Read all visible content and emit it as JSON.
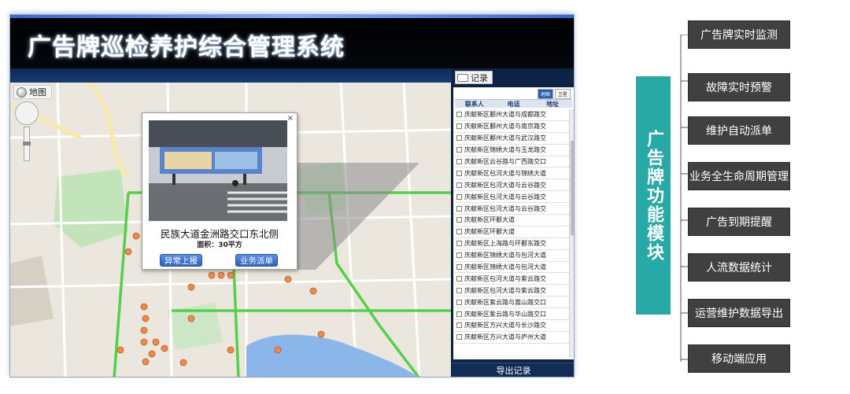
{
  "app": {
    "title": "广告牌巡检养护综合管理系统"
  },
  "map": {
    "tab_label": "地图",
    "popup": {
      "close_label": "×",
      "location": "民族大道金洲路交口东北侧",
      "area": "面积：30平方",
      "btn_report": "异常上报",
      "btn_dispatch": "业务派单"
    }
  },
  "records": {
    "tab_label": "记录",
    "mini_tabs": [
      "地图",
      "卫星"
    ],
    "columns": [
      "联系人",
      "电话",
      "地址"
    ],
    "rows": [
      "庆献新区鄱州大道与成都路交",
      "庆献新区鄱州大道与南京路交",
      "庆献新区鄱州大道与武汉路交",
      "庆献新区锦绣大道与玉龙路交",
      "庆献新区云谷路与广西路交口",
      "庆献新区包河大道与锦绣大道",
      "庆献新区包河大道与云谷路交",
      "庆献新区包河大道与云谷路交",
      "庆献新区包河大道与云谷路交",
      "庆献新区环鄱大道",
      "庆献新区环鄱大道",
      "庆献新区上海路与环鄱东路交",
      "庆献新区锦绣大道与包河大道",
      "庆献新区锦绣大道与包河大道",
      "庆献新区包河大道与紫云路交",
      "庆献新区包河大道与紫云路交",
      "庆献新区紫云路与嵩山路交口",
      "庆献新区紫云路与华山路交口",
      "庆献新区方兴大道与长沙路交",
      "庆献新区方兴大道与庐州大道"
    ],
    "export_label": "导出记录"
  },
  "module": {
    "title": "广告牌功能模块",
    "features": [
      "广告牌实时监测",
      "故障实时预警",
      "维护自动派单",
      "业务全生命周期管理",
      "广告到期提醒",
      "人流数据统计",
      "运营维护数据导出",
      "移动端应用"
    ]
  },
  "colors": {
    "module_accent": "#28a9a5",
    "feature_box": "#404040",
    "panel_dark": "#0d2346",
    "button_blue": "#2e62bf",
    "road_green": "#55d04a",
    "marker_orange": "#ef8a4a"
  }
}
